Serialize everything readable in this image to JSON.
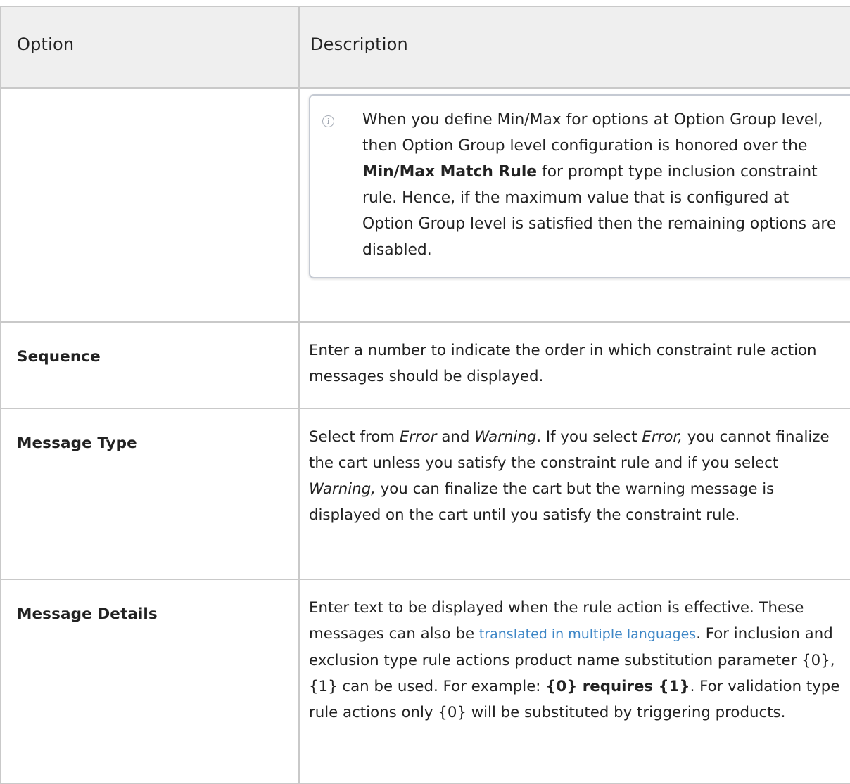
{
  "table": {
    "headers": {
      "option": "Option",
      "description": "Description"
    },
    "note": {
      "icon": "info-icon",
      "part1": "When you define Min/Max for options at Option Group level, then Option Group level configuration is honored over the ",
      "bold": "Min/Max Match Rule",
      "part2": " for prompt type inclusion constraint rule. Hence, if the maximum value that is configured at Option Group level is satisfied then the remaining options are disabled."
    },
    "rows": [
      {
        "option": "Sequence",
        "description": "Enter a number to indicate the order in which constraint rule action messages should be displayed."
      },
      {
        "option": "Message Type",
        "desc_part1": "Select from ",
        "desc_italic1": "Error",
        "desc_part2": " and ",
        "desc_italic2": "Warning",
        "desc_part3": ". If you select ",
        "desc_italic3": "Error,",
        "desc_part4": " you cannot finalize the cart unless you satisfy the constraint rule and if you select ",
        "desc_italic4": "Warning,",
        "desc_part5": " you can finalize the cart but the warning message is displayed on the cart until you satisfy the constraint rule."
      },
      {
        "option": "Message Details",
        "desc_part1": "Enter text to be displayed when the rule action is effective. These messages can also be ",
        "link": "translated in multiple languages",
        "desc_part2": ". For inclusion and exclusion type rule actions product name substitution parameter {0}, {1} can be used. For example: ",
        "desc_bold": "{0} requires {1}",
        "desc_part3": ". For validation type rule actions only {0} will be substituted by triggering products."
      }
    ]
  }
}
